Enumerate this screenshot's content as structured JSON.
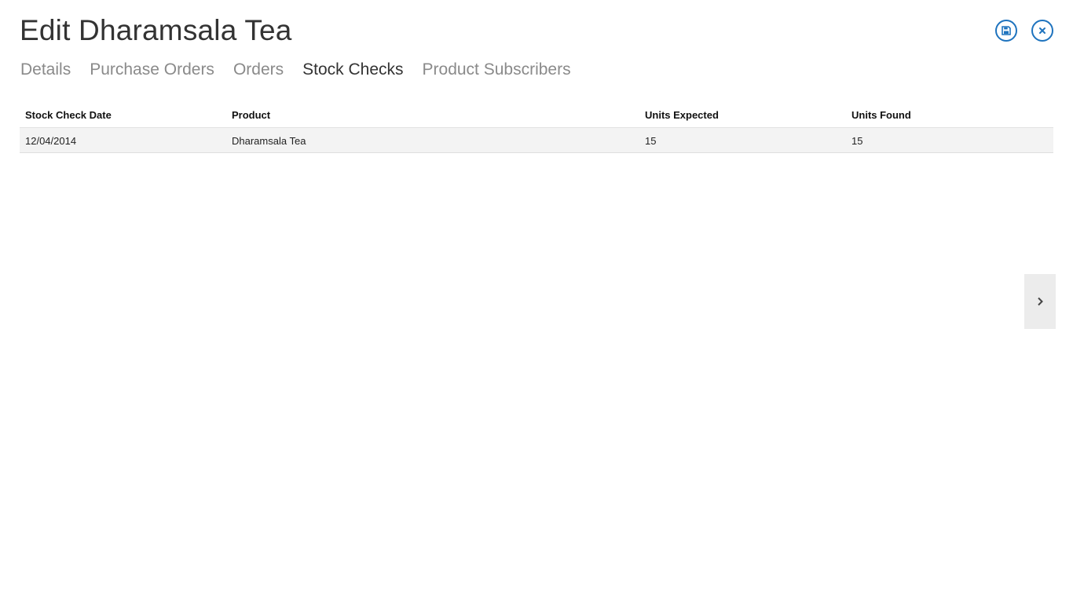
{
  "header": {
    "title": "Edit Dharamsala Tea",
    "save_icon": "save-icon",
    "close_icon": "close-icon",
    "accent_color": "#1e73be"
  },
  "tabs": [
    {
      "label": "Details",
      "active": false
    },
    {
      "label": "Purchase Orders",
      "active": false
    },
    {
      "label": "Orders",
      "active": false
    },
    {
      "label": "Stock Checks",
      "active": true
    },
    {
      "label": "Product Subscribers",
      "active": false
    }
  ],
  "table": {
    "columns": [
      "Stock Check Date",
      "Product",
      "Units Expected",
      "Units Found"
    ],
    "rows": [
      [
        "12/04/2014",
        "Dharamsala Tea",
        "15",
        "15"
      ]
    ]
  },
  "side_nav": {
    "icon": "chevron-right-icon"
  }
}
